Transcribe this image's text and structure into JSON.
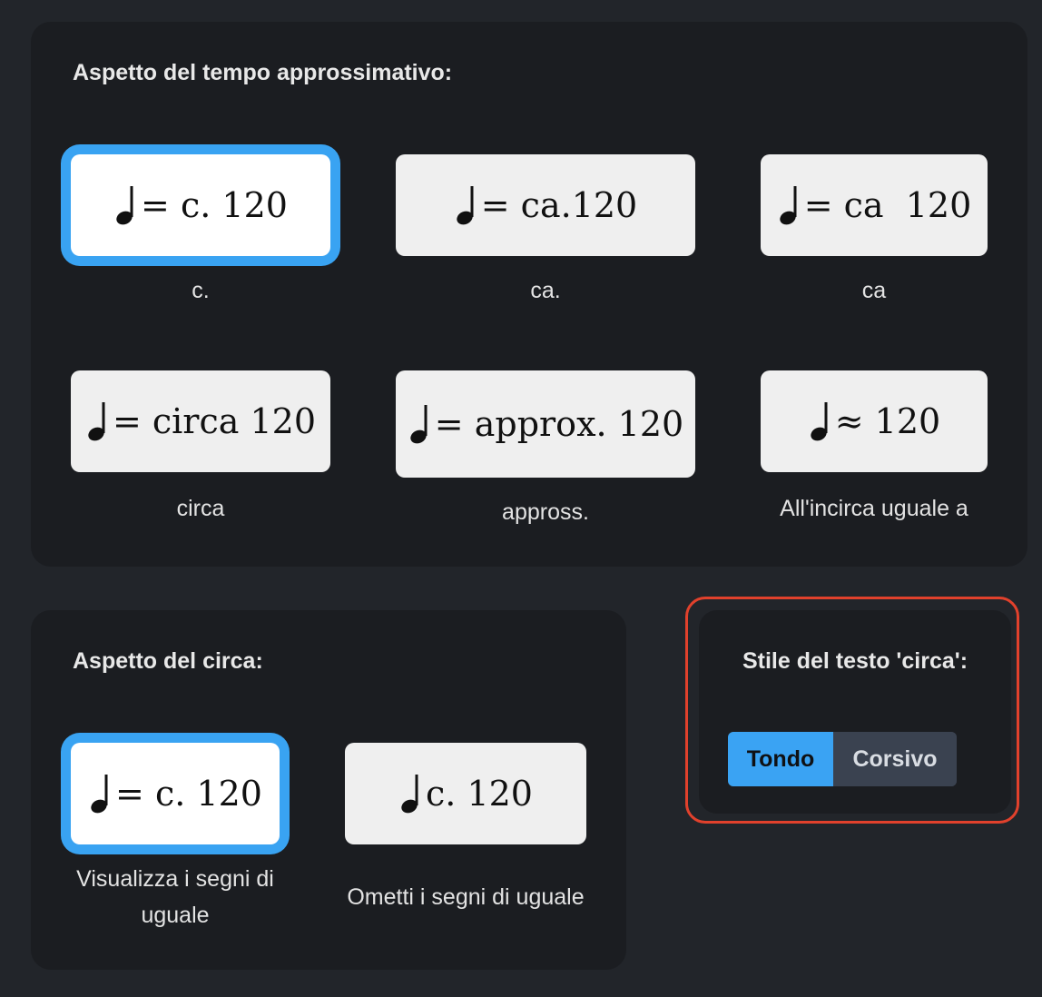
{
  "tempo_section": {
    "heading": "Aspetto del tempo approssimativo:",
    "options": [
      {
        "preview": "= c. 120",
        "label": "c.",
        "selected": true
      },
      {
        "preview": "= ca.120",
        "label": "ca.",
        "selected": false
      },
      {
        "preview": "= ca  120",
        "label": "ca",
        "selected": false
      },
      {
        "preview": "= circa 120",
        "label": "circa",
        "selected": false
      },
      {
        "preview": "= approx. 120",
        "label": "appross.",
        "selected": false
      },
      {
        "preview": "≈ 120",
        "label": "All'incirca uguale a",
        "selected": false
      }
    ]
  },
  "circa_section": {
    "heading": "Aspetto del circa:",
    "options": [
      {
        "preview": "= c. 120",
        "label": "Visualizza i segni di uguale",
        "selected": true
      },
      {
        "preview": "c. 120",
        "label": "Ometti i segni di uguale",
        "selected": false
      }
    ]
  },
  "style_section": {
    "heading": "Stile del testo 'circa':",
    "buttons": [
      {
        "label": "Tondo",
        "active": true
      },
      {
        "label": "Corsivo",
        "active": false
      }
    ]
  },
  "colors": {
    "accent": "#39a3f2",
    "highlight": "#e1412c",
    "panel": "#1b1d21",
    "background": "#22252a"
  },
  "icons": {
    "note": "quarter-note-icon"
  }
}
